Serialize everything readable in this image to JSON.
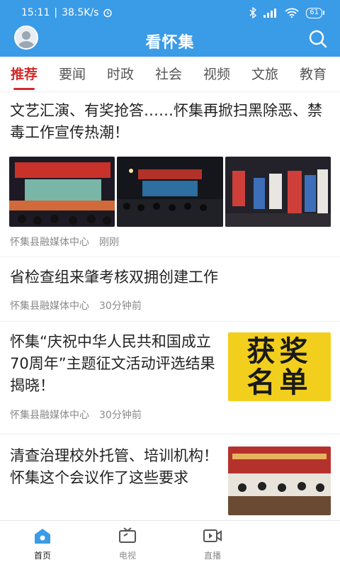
{
  "status_bar": {
    "time": "15:11",
    "speed": "38.5K/s",
    "battery": "61"
  },
  "header": {
    "title": "看怀集"
  },
  "tabs": [
    {
      "label": "推荐",
      "active": true
    },
    {
      "label": "要闻"
    },
    {
      "label": "时政"
    },
    {
      "label": "社会"
    },
    {
      "label": "视频"
    },
    {
      "label": "文旅"
    },
    {
      "label": "教育"
    }
  ],
  "news": [
    {
      "title": "文艺汇演、有奖抢答……怀集再掀扫黑除恶、禁毒工作宣传热潮！",
      "source": "怀集县融媒体中心",
      "time": "刚刚"
    },
    {
      "title": "省检查组来肇考核双拥创建工作",
      "source": "怀集县融媒体中心",
      "time": "30分钟前"
    },
    {
      "title": "怀集“庆祝中华人民共和国成立70周年”主题征文活动评选结果揭晓！",
      "source": "怀集县融媒体中心",
      "time": "30分钟前",
      "thumb_text": "获奖名单"
    },
    {
      "title": "清查治理校外托管、培训机构！怀集这个会议作了这些要求"
    }
  ],
  "bottom_nav": [
    {
      "label": "首页",
      "icon": "home-icon",
      "active": true
    },
    {
      "label": "电视",
      "icon": "tv-icon"
    },
    {
      "label": "直播",
      "icon": "live-icon"
    },
    {
      "label": ""
    }
  ],
  "colors": {
    "brand": "#3a9be7",
    "active_tab": "#d12a2a"
  }
}
